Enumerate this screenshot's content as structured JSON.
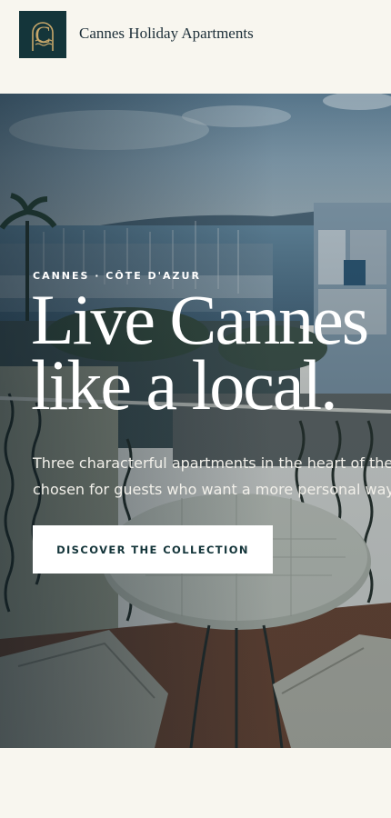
{
  "header": {
    "logo_letter": "C",
    "brand_name": "Cannes Holiday Apartments"
  },
  "hero": {
    "eyebrow": "CANNES · CÔTE D'AZUR",
    "headline": [
      "Live Cannes",
      "like a local."
    ],
    "lead": [
      "Three characterful apartments in the heart of the c",
      "chosen for guests who want a more personal way t"
    ],
    "cta_label": "DISCOVER THE COLLECTION"
  },
  "colors": {
    "background": "#f8f6ef",
    "logo_bg": "#14353a",
    "logo_gold": "#c9a86a",
    "cta_text": "#14353a"
  }
}
